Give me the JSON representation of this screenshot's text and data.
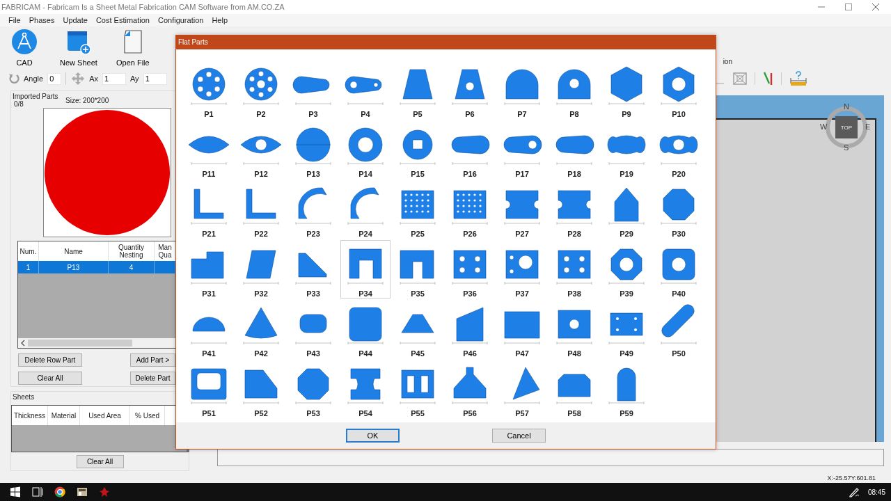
{
  "window": {
    "title": "FABRICAM - Fabricam Is a Sheet Metal Fabrication CAM Software from AM.CO.ZA"
  },
  "menu": [
    "File",
    "Phases",
    "Update",
    "Cost Estimation",
    "Configuration",
    "Help"
  ],
  "toolbar": [
    {
      "kind": "cad",
      "label": "CAD"
    },
    {
      "kind": "new-sheet",
      "label": "New Sheet"
    },
    {
      "kind": "open-file",
      "label": "Open File"
    }
  ],
  "transform": {
    "angle_label": "Angle",
    "angle": "0",
    "ax_label": "Ax",
    "ax": "1",
    "ay_label": "Ay",
    "ay": "1"
  },
  "right_toolbar": {
    "label": "ion"
  },
  "imported_parts": {
    "title": "Imported Parts",
    "count": "0/8",
    "size": "Size: 200*200",
    "columns": [
      "Num.",
      "Name",
      "Quantity Nesting",
      "Man Qua"
    ],
    "rows": [
      {
        "cells": [
          "1",
          "P13",
          "4",
          ""
        ],
        "selected": true
      }
    ],
    "buttons": [
      "Delete Row Part",
      "Add Part >",
      "Clear All",
      "Delete Part"
    ]
  },
  "sheets": {
    "title": "Sheets",
    "columns": [
      "Thickness",
      "Material",
      "Used Area",
      "% Used"
    ],
    "button": "Clear All"
  },
  "view": {
    "compass": {
      "north": "N",
      "west": "W",
      "east": "E",
      "south": "S",
      "face": "TOP"
    }
  },
  "status_bar": {
    "coordinates": "X:-25.57Y:601.81"
  },
  "taskbar": {
    "time": "08:45"
  },
  "dialog": {
    "title": "Flat Parts",
    "parts": [
      {
        "label": "P1",
        "kind": "disc-holes",
        "selected": false
      },
      {
        "label": "P2",
        "kind": "disc-holes-center",
        "selected": false
      },
      {
        "label": "P3",
        "kind": "slot",
        "selected": false
      },
      {
        "label": "P4",
        "kind": "slot-holes",
        "selected": false
      },
      {
        "label": "P5",
        "kind": "trapezoid",
        "selected": false
      },
      {
        "label": "P6",
        "kind": "trapezoid-hole",
        "selected": false
      },
      {
        "label": "P7",
        "kind": "arch",
        "selected": false
      },
      {
        "label": "P8",
        "kind": "arch-hole",
        "selected": false
      },
      {
        "label": "P9",
        "kind": "hexagon",
        "selected": false
      },
      {
        "label": "P10",
        "kind": "hexagon-hole",
        "selected": false
      },
      {
        "label": "P11",
        "kind": "lens",
        "selected": false
      },
      {
        "label": "P12",
        "kind": "lens-hole",
        "selected": false
      },
      {
        "label": "P13",
        "kind": "disc",
        "selected": false
      },
      {
        "label": "P14",
        "kind": "ring",
        "selected": false
      },
      {
        "label": "P15",
        "kind": "disc-square",
        "selected": false
      },
      {
        "label": "P16",
        "kind": "dumbbell",
        "selected": false
      },
      {
        "label": "P17",
        "kind": "dumbbell-hole",
        "selected": false
      },
      {
        "label": "P18",
        "kind": "dumbbell",
        "selected": false
      },
      {
        "label": "P19",
        "kind": "bone",
        "selected": false
      },
      {
        "label": "P20",
        "kind": "bone-hole",
        "selected": false
      },
      {
        "label": "P21",
        "kind": "l-shape",
        "selected": false
      },
      {
        "label": "P22",
        "kind": "l-shape",
        "selected": false
      },
      {
        "label": "P23",
        "kind": "quarter-arc",
        "selected": false
      },
      {
        "label": "P24",
        "kind": "quarter-arc",
        "selected": false
      },
      {
        "label": "P25",
        "kind": "perforated",
        "selected": false
      },
      {
        "label": "P26",
        "kind": "perforated",
        "selected": false
      },
      {
        "label": "P27",
        "kind": "notched",
        "selected": false
      },
      {
        "label": "P28",
        "kind": "notched",
        "selected": false
      },
      {
        "label": "P29",
        "kind": "house",
        "selected": false
      },
      {
        "label": "P30",
        "kind": "octagon",
        "selected": false
      },
      {
        "label": "P31",
        "kind": "step",
        "selected": false
      },
      {
        "label": "P32",
        "kind": "parallelogram",
        "selected": false
      },
      {
        "label": "P33",
        "kind": "slope",
        "selected": false
      },
      {
        "label": "P34",
        "kind": "u-frame",
        "selected": true
      },
      {
        "label": "P35",
        "kind": "c-frame",
        "selected": false
      },
      {
        "label": "P36",
        "kind": "rect-holes",
        "selected": false
      },
      {
        "label": "P37",
        "kind": "rect-big-hole",
        "selected": false
      },
      {
        "label": "P38",
        "kind": "rect-holes",
        "selected": false
      },
      {
        "label": "P39",
        "kind": "octagon-hole",
        "selected": false
      },
      {
        "label": "P40",
        "kind": "rounded-hole",
        "selected": false
      },
      {
        "label": "P41",
        "kind": "half-disc",
        "selected": false
      },
      {
        "label": "P42",
        "kind": "sector",
        "selected": false
      },
      {
        "label": "P43",
        "kind": "rounded-small",
        "selected": false
      },
      {
        "label": "P44",
        "kind": "rounded",
        "selected": false
      },
      {
        "label": "P45",
        "kind": "flat-trap",
        "selected": false
      },
      {
        "label": "P46",
        "kind": "quad",
        "selected": false
      },
      {
        "label": "P47",
        "kind": "rect",
        "selected": false
      },
      {
        "label": "P48",
        "kind": "rect-hole",
        "selected": false
      },
      {
        "label": "P49",
        "kind": "rect-dots",
        "selected": false
      },
      {
        "label": "P50",
        "kind": "slant-slot",
        "selected": false
      },
      {
        "label": "P51",
        "kind": "frame",
        "selected": false
      },
      {
        "label": "P52",
        "kind": "cut-rect",
        "selected": false
      },
      {
        "label": "P53",
        "kind": "octagon",
        "selected": false
      },
      {
        "label": "P54",
        "kind": "i-shape",
        "selected": false
      },
      {
        "label": "P55",
        "kind": "two-windows",
        "selected": false
      },
      {
        "label": "P56",
        "kind": "flask",
        "selected": false
      },
      {
        "label": "P57",
        "kind": "triangle",
        "selected": false
      },
      {
        "label": "P58",
        "kind": "chamfer",
        "selected": false
      },
      {
        "label": "P59",
        "kind": "tall-arch",
        "selected": false
      }
    ],
    "buttons": [
      {
        "label": "OK",
        "default": true
      },
      {
        "label": "Cancel",
        "default": false
      }
    ]
  }
}
